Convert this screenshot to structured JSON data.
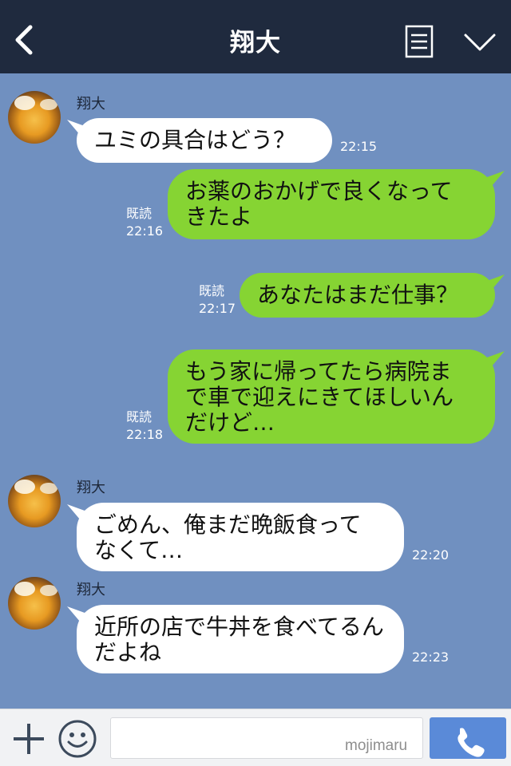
{
  "header": {
    "title": "翔大",
    "back_icon": "chevron-left-icon",
    "menu_icon": "note-list-icon",
    "expand_icon": "chevron-down-icon"
  },
  "messages": [
    {
      "sender": "翔大",
      "text": "ユミの具合はどう？",
      "time": "22:15"
    },
    {
      "line1": "お薬のおかげで良くなって",
      "line2": "きたよ",
      "read": "既読",
      "time": "22:16"
    },
    {
      "text": "あなたはまだ仕事？",
      "read": "既読",
      "time": "22:17"
    },
    {
      "line1": "もう家に帰ってたら病院ま",
      "line2": "で車で迎えにきてほしいん",
      "line3": "だけど…",
      "read": "既読",
      "time": "22:18"
    },
    {
      "sender": "翔大",
      "line1": "ごめん、俺まだ晩飯食って",
      "line2": "なくて…",
      "time": "22:20"
    },
    {
      "sender": "翔大",
      "line1": "近所の店で牛丼を食べてるん",
      "line2": "だよね",
      "time": "22:23"
    }
  ],
  "footer": {
    "input_value": "",
    "watermark": "mojimaru",
    "plus_icon": "plus-icon",
    "sticker_icon": "smiley-icon",
    "call_icon": "phone-icon"
  },
  "colors": {
    "header_bg": "#1f2a3e",
    "chat_bg": "#7090c0",
    "incoming_bubble": "#ffffff",
    "outgoing_bubble": "#86d433",
    "call_button": "#5a8ad8"
  }
}
